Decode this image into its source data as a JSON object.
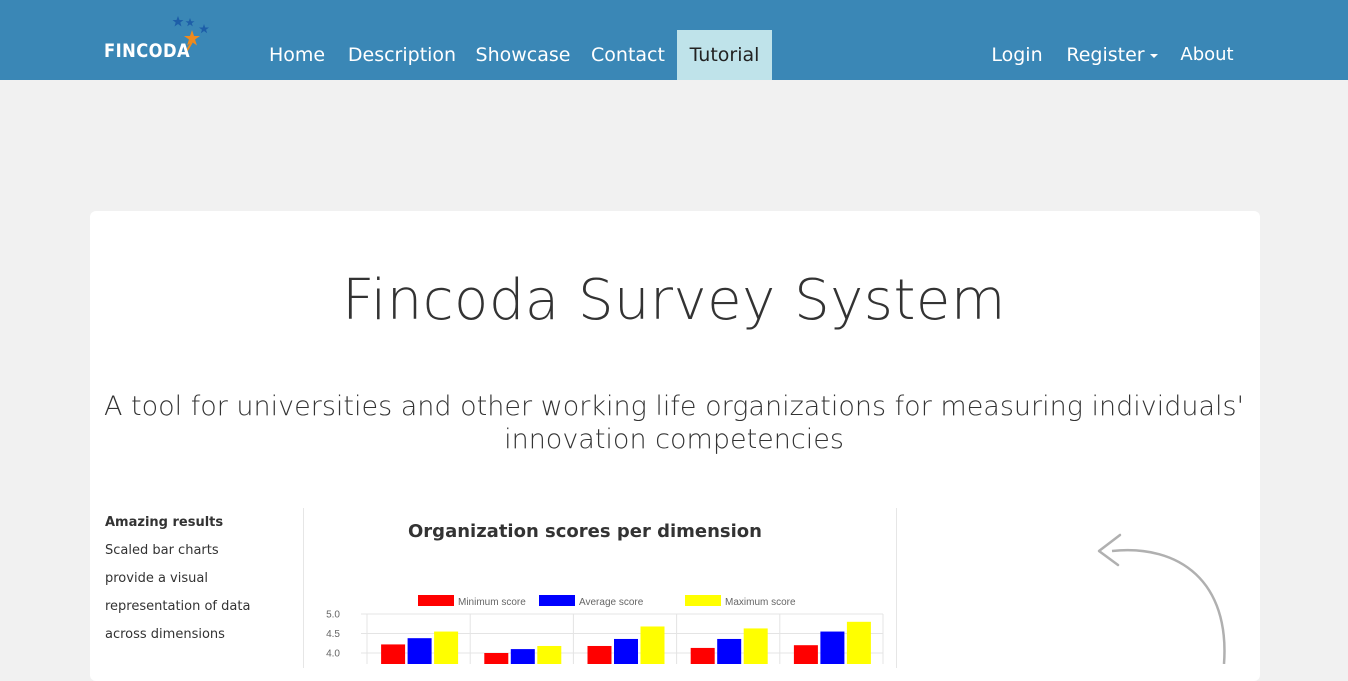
{
  "nav": {
    "brand": "FINCODA",
    "links": [
      {
        "label": "Home",
        "active": false
      },
      {
        "label": "Description",
        "active": false
      },
      {
        "label": "Showcase",
        "active": false
      },
      {
        "label": "Contact",
        "active": false
      },
      {
        "label": "Tutorial",
        "active": true
      }
    ],
    "right": {
      "login": "Login",
      "register": "Register",
      "about": "About"
    }
  },
  "hero": {
    "title": "Fincoda Survey System",
    "subtitle": "A tool for universities and other working life organizations for measuring individuals' innovation competencies"
  },
  "feature": {
    "heading": "Amazing results",
    "lines": [
      "Scaled bar charts",
      "provide a visual",
      "representation of data",
      "across dimensions"
    ]
  },
  "colors": {
    "navbar": "#3a87b6",
    "active_tab": "#bfe3ea",
    "min": "#ff0000",
    "avg": "#0000ff",
    "max": "#ffff00"
  },
  "chart_data": {
    "type": "bar",
    "title": "Organization scores per dimension",
    "xlabel": "",
    "ylabel": "",
    "ylim": [
      3.8,
      5.0
    ],
    "yticks": [
      "5.0",
      "4.5",
      "4.0"
    ],
    "legend_position": "top",
    "categories": [
      "",
      "",
      "",
      "",
      ""
    ],
    "series": [
      {
        "name": "Minimum score",
        "color": "#ff0000",
        "values": [
          4.22,
          4.0,
          4.18,
          4.13,
          4.2
        ]
      },
      {
        "name": "Average score",
        "color": "#0000ff",
        "values": [
          4.38,
          4.1,
          4.36,
          4.36,
          4.55
        ]
      },
      {
        "name": "Maximum score",
        "color": "#ffff00",
        "values": [
          4.55,
          4.18,
          4.68,
          4.63,
          4.8
        ]
      }
    ]
  }
}
